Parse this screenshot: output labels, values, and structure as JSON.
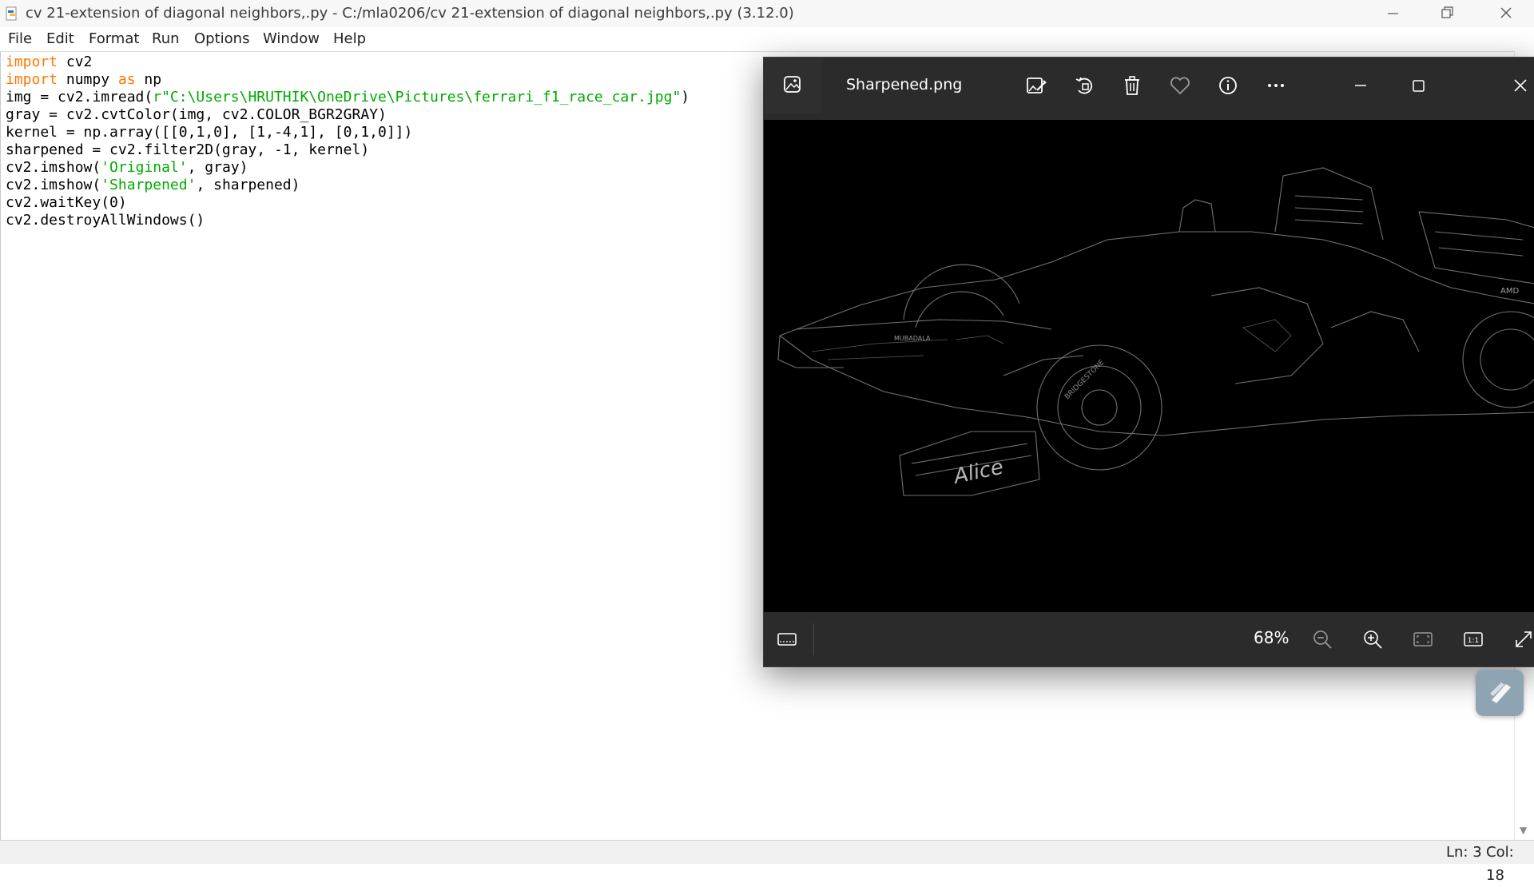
{
  "idle": {
    "window_title": "cv 21-extension of diagonal neighbors,.py - C:/mla0206/cv 21-extension of diagonal neighbors,.py (3.12.0)",
    "menu": [
      "File",
      "Edit",
      "Format",
      "Run",
      "Options",
      "Window",
      "Help"
    ],
    "code_lines": [
      [
        {
          "t": "import",
          "c": "kw"
        },
        {
          "t": " cv2",
          "c": ""
        }
      ],
      [
        {
          "t": "import",
          "c": "kw"
        },
        {
          "t": " numpy ",
          "c": ""
        },
        {
          "t": "as",
          "c": "kw"
        },
        {
          "t": " np",
          "c": ""
        }
      ],
      [
        {
          "t": "img = cv2.imread(",
          "c": ""
        },
        {
          "t": "r\"C:\\Users\\HRUTHIK\\OneDrive\\Pictures\\ferrari_f1_race_car.jpg\"",
          "c": "str"
        },
        {
          "t": ")",
          "c": ""
        }
      ],
      [
        {
          "t": "gray = cv2.cvtColor(img, cv2.COLOR_BGR2GRAY)",
          "c": ""
        }
      ],
      [
        {
          "t": "kernel = np.array([[0,1,0], [1,-4,1], [0,1,0]])",
          "c": ""
        }
      ],
      [
        {
          "t": "sharpened = cv2.filter2D(gray, -1, kernel)",
          "c": ""
        }
      ],
      [
        {
          "t": "cv2.imshow(",
          "c": ""
        },
        {
          "t": "'Original'",
          "c": "str"
        },
        {
          "t": ", gray)",
          "c": ""
        }
      ],
      [
        {
          "t": "cv2.imshow(",
          "c": ""
        },
        {
          "t": "'Sharpened'",
          "c": "str"
        },
        {
          "t": ", sharpened)",
          "c": ""
        }
      ],
      [
        {
          "t": "cv2.waitKey(0)",
          "c": ""
        }
      ],
      [
        {
          "t": "cv2.destroyAllWindows()",
          "c": ""
        }
      ]
    ],
    "status": {
      "line": "Ln: 3",
      "col": "Col: 18"
    }
  },
  "viewer": {
    "title": "Sharpened.png",
    "zoom": "68%",
    "toolbar_icons": [
      "edit-image-icon",
      "rotate-icon",
      "delete-icon",
      "favorite-heart-icon",
      "info-icon",
      "more-options-icon"
    ],
    "window_controls": [
      "minimize-icon",
      "maximize-icon",
      "close-icon"
    ],
    "bottom_icons": [
      "filmstrip-icon",
      "zoom-out-icon",
      "zoom-in-icon",
      "fit-to-window-icon",
      "actual-size-icon",
      "fullscreen-icon"
    ],
    "image_alt_text": [
      "MUBADALA",
      "BRIDGESTONE",
      "Alice",
      "AMD"
    ]
  },
  "colors": {
    "keyword": "#ff7700",
    "string": "#00aa00",
    "viewer_bg": "#202020",
    "viewer_chrome": "#2b2b2b"
  }
}
